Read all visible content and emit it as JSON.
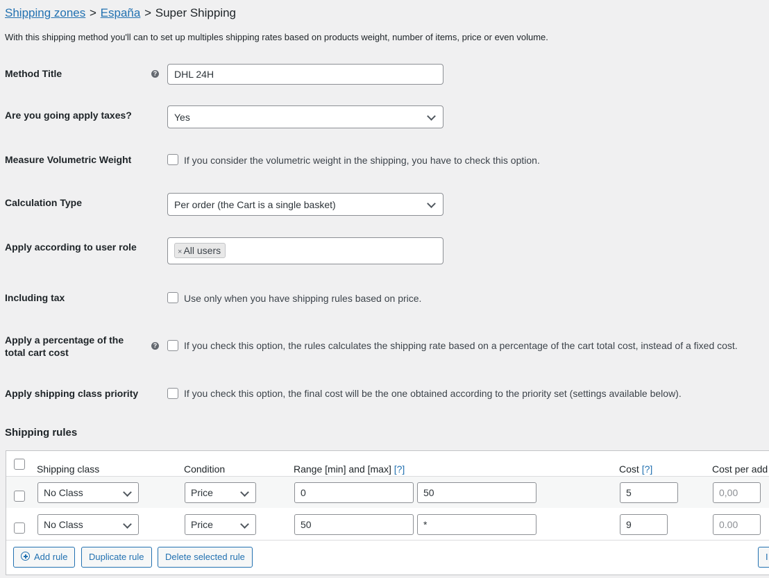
{
  "breadcrumb": {
    "link1": "Shipping zones",
    "sep1": ">",
    "link2": "España",
    "sep2": ">",
    "current": "Super Shipping"
  },
  "description": "With this shipping method you'll can to set up multiples shipping rates based on products weight, number of items, price or even volume.",
  "form": {
    "method_title": {
      "label": "Method Title",
      "value": "DHL 24H"
    },
    "apply_taxes": {
      "label": "Are you going apply taxes?",
      "value": "Yes"
    },
    "volumetric": {
      "label": "Measure Volumetric Weight",
      "text": "If you consider the volumetric weight in the shipping, you have to check this option.",
      "checked": false
    },
    "calc_type": {
      "label": "Calculation Type",
      "value": "Per order (the Cart is a single basket)"
    },
    "user_role": {
      "label": "Apply according to user role",
      "tag": "All users",
      "remove": "×"
    },
    "including_tax": {
      "label": "Including tax",
      "text": "Use only when you have shipping rules based on price.",
      "checked": false
    },
    "percentage": {
      "label_line1": "Apply a percentage of the",
      "label_line2": "total cart cost",
      "text": "If you check this option, the rules calculates the shipping rate based on a percentage of the cart total cost, instead of a fixed cost.",
      "checked": false
    },
    "class_priority": {
      "label": "Apply shipping class priority",
      "text": "If you check this option, the final cost will be the one obtained according to the priority set (settings available below).",
      "checked": false
    }
  },
  "help_icon": "?",
  "rules": {
    "heading": "Shipping rules",
    "columns": {
      "shipping_class": "Shipping class",
      "condition": "Condition",
      "range": "Range [min] and [max]",
      "range_help": "[?]",
      "cost": "Cost",
      "cost_help": "[?]",
      "cost_per_add": "Cost per add"
    },
    "rows": [
      {
        "class": "No Class",
        "condition": "Price",
        "min": "0",
        "max": "50",
        "cost": "5",
        "cost_per_add": "0,00"
      },
      {
        "class": "No Class",
        "condition": "Price",
        "min": "50",
        "max": "*",
        "cost": "9",
        "cost_per_add": "0.00"
      }
    ],
    "buttons": {
      "add": "Add rule",
      "duplicate": "Duplicate rule",
      "delete": "Delete selected rule",
      "partial_right": "I"
    }
  },
  "colors": {
    "link": "#2271b1",
    "background": "#f0f0f1",
    "row_alt": "#f6f7f7"
  }
}
